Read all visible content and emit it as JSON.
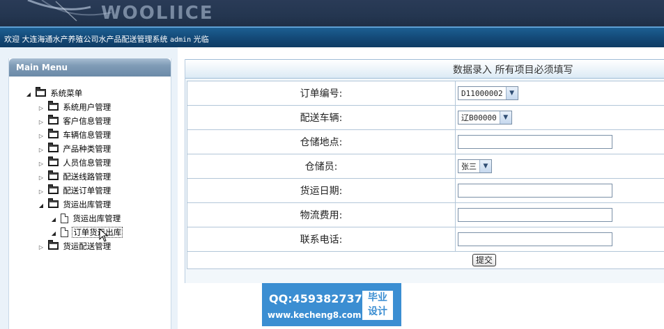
{
  "header": {
    "logo_text": "WOOLIICE",
    "welcome": "欢迎 大连海通水产养殖公司水产品配送管理系统",
    "user": "admin",
    "welcome_suffix": "光临"
  },
  "menu": {
    "title": "Main Menu",
    "root": "系统菜单",
    "items": [
      {
        "label": "系统用户管理"
      },
      {
        "label": "客户信息管理"
      },
      {
        "label": "车辆信息管理"
      },
      {
        "label": "产品种类管理"
      },
      {
        "label": "人员信息管理"
      },
      {
        "label": "配送线路管理"
      },
      {
        "label": "配送订单管理"
      },
      {
        "label": "货运出库管理",
        "children": [
          "货运出库管理",
          "订单货运出库"
        ]
      },
      {
        "label": "货运配送管理"
      }
    ]
  },
  "form": {
    "header": "数据录入 所有项目必须填写",
    "rows": [
      {
        "label": "订单编号:",
        "type": "select",
        "value": "D11000002"
      },
      {
        "label": "配送车辆:",
        "type": "select",
        "value": "辽B00000"
      },
      {
        "label": "仓储地点:",
        "type": "text",
        "value": ""
      },
      {
        "label": "仓储员:",
        "type": "select",
        "value": "张三"
      },
      {
        "label": "货运日期:",
        "type": "text",
        "value": ""
      },
      {
        "label": "物流费用:",
        "type": "text",
        "value": ""
      },
      {
        "label": "联系电话:",
        "type": "text",
        "value": ""
      }
    ],
    "submit": "提交"
  },
  "watermark": {
    "qq": "QQ:459382737",
    "url": "www.kecheng8.com",
    "badge_line1": "毕业",
    "badge_line2": "设计"
  },
  "colors": {
    "header_bg": "#243650",
    "welcome_bar": "#144a78",
    "menu_title": "#7f9bb6",
    "watermark_bg": "#3b8ed2"
  }
}
